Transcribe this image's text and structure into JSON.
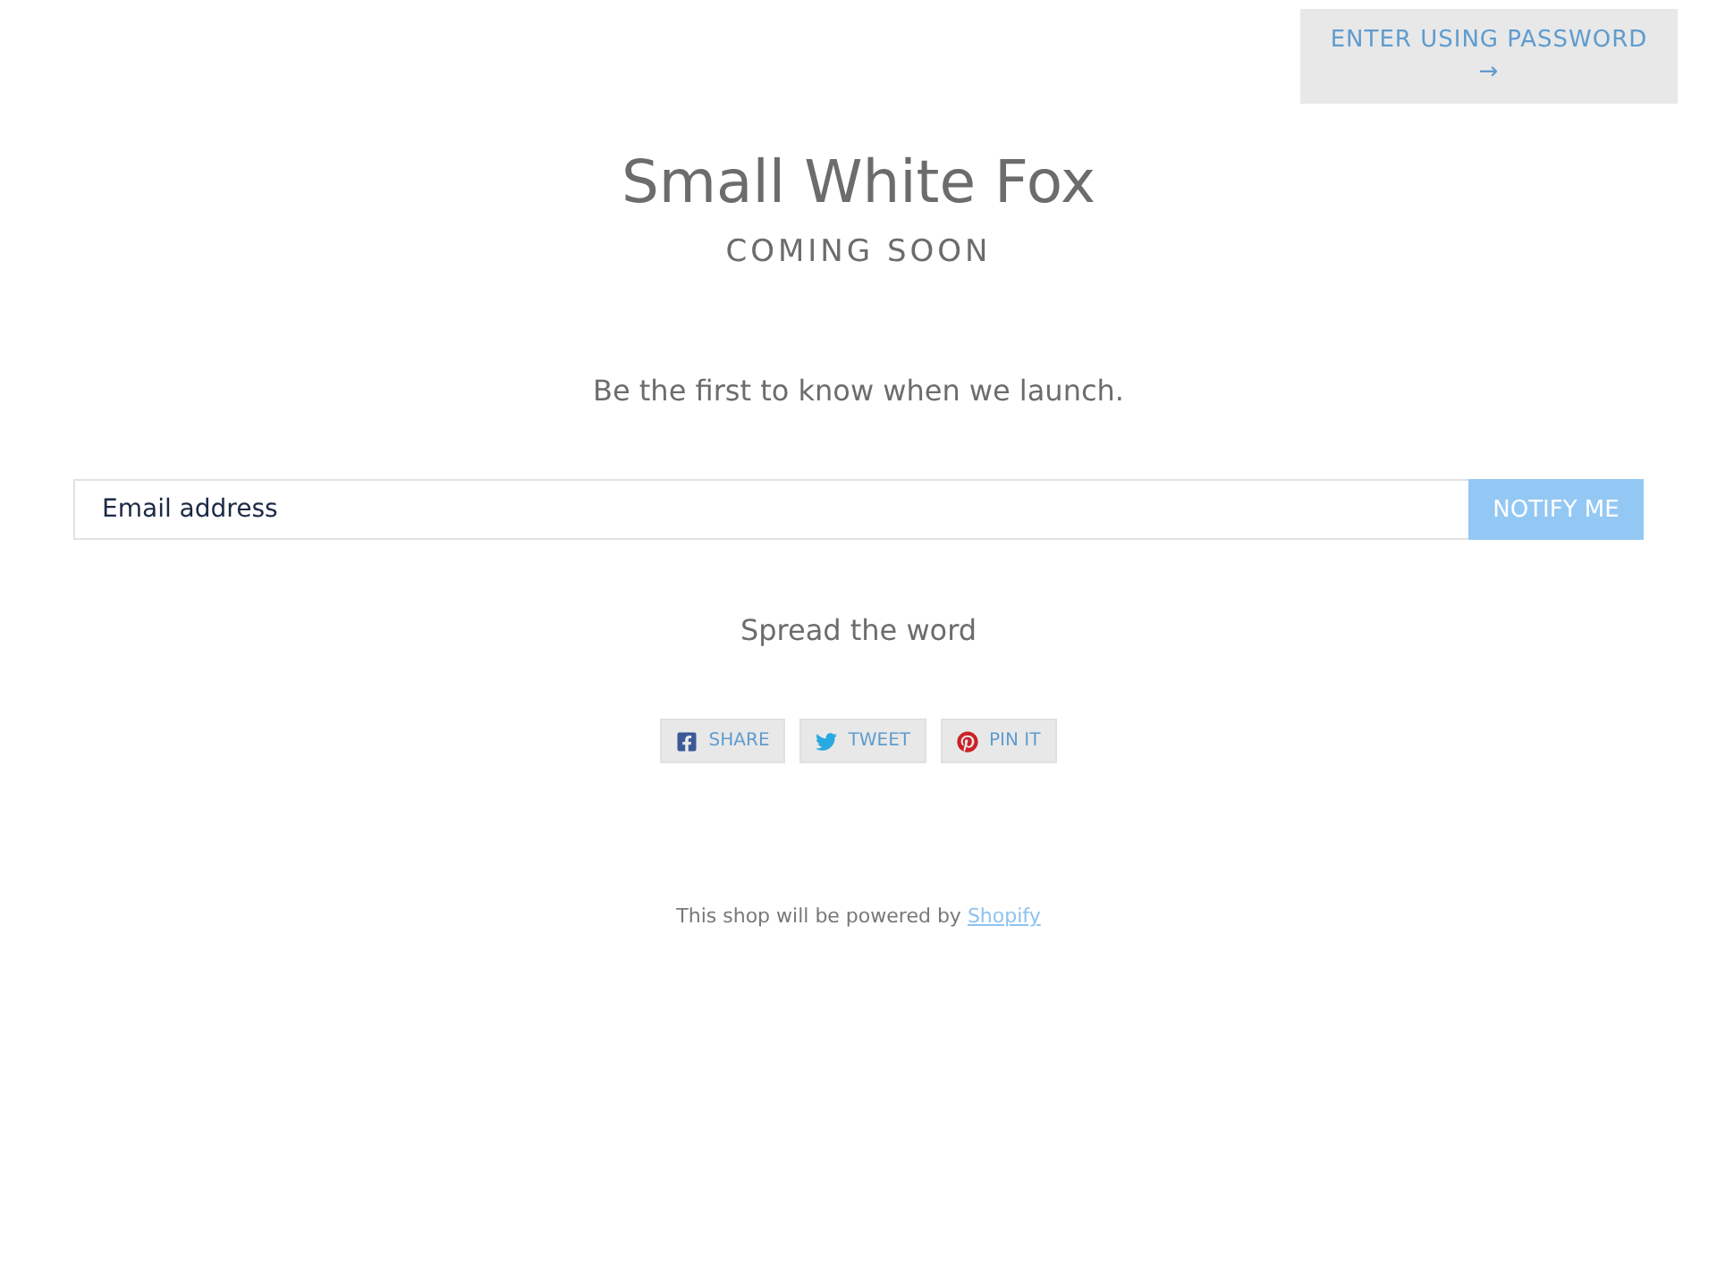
{
  "header": {
    "password_button": {
      "label": "ENTER USING PASSWORD",
      "arrow": "→"
    }
  },
  "hero": {
    "title": "Small White Fox",
    "subtitle": "COMING SOON",
    "message": "Be the first to know when we launch."
  },
  "signup": {
    "placeholder": "Email address",
    "button": "NOTIFY ME"
  },
  "share": {
    "heading": "Spread the word",
    "buttons": [
      {
        "kind": "facebook",
        "label": "SHARE"
      },
      {
        "kind": "twitter",
        "label": "TWEET"
      },
      {
        "kind": "pinterest",
        "label": "PIN IT"
      }
    ]
  },
  "footer": {
    "text": "This shop will be powered by",
    "link": "Shopify"
  }
}
